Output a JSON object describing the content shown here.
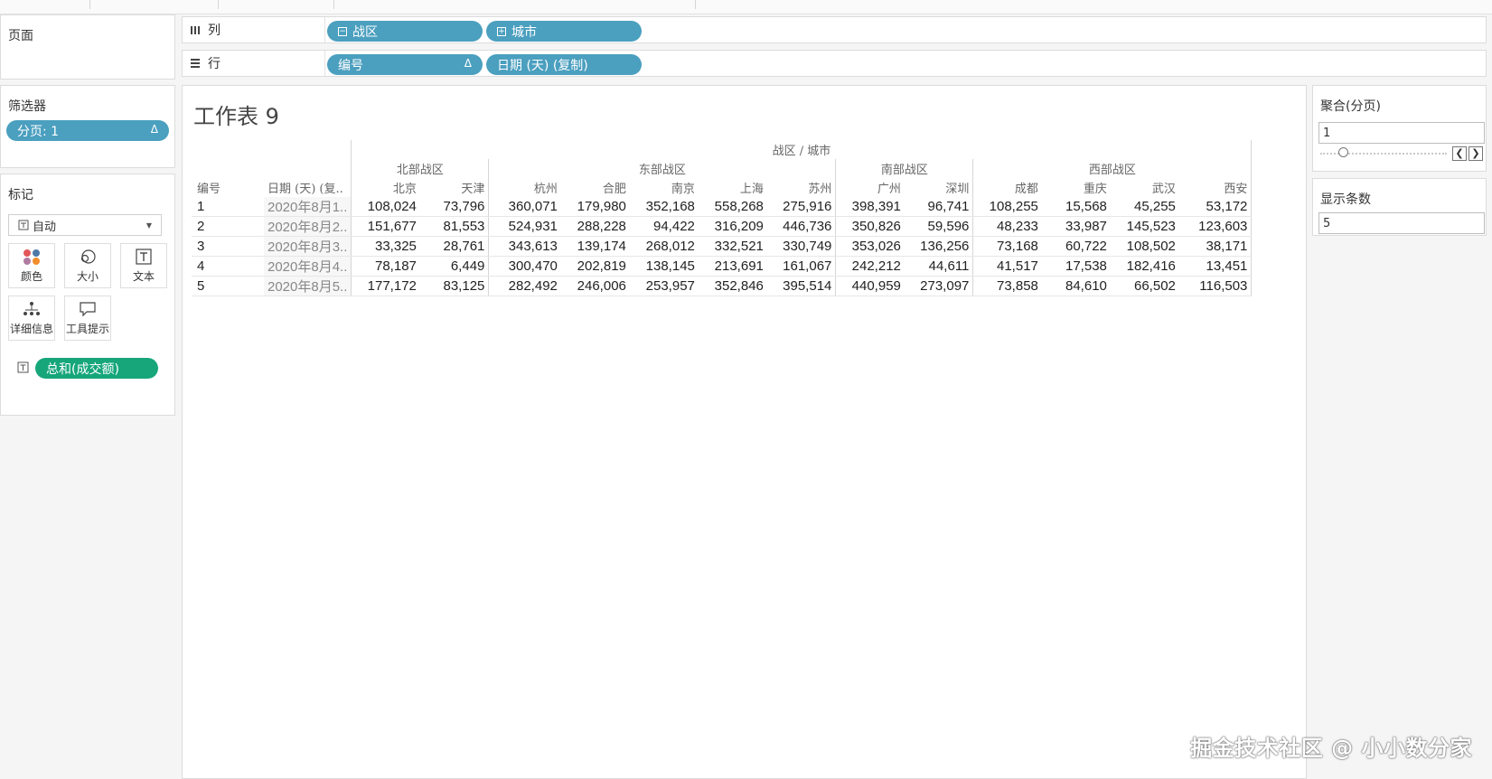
{
  "left": {
    "pages_title": "页面",
    "filters_title": "筛选器",
    "filter_pill": "分页: 1",
    "filter_pill_delta": "Δ",
    "marks_title": "标记",
    "mark_type": "自动",
    "mark_buttons": [
      {
        "label": "颜色",
        "icon": "color-dots-icon"
      },
      {
        "label": "大小",
        "icon": "size-circles-icon"
      },
      {
        "label": "文本",
        "icon": "text-icon"
      },
      {
        "label": "详细信息",
        "icon": "detail-icon"
      },
      {
        "label": "工具提示",
        "icon": "tooltip-icon"
      }
    ],
    "marks_field": "总和(成交额)"
  },
  "shelves": {
    "columns_label": "列",
    "rows_label": "行",
    "column_pills": [
      "战区",
      "城市"
    ],
    "row_pills": [
      "编号",
      "日期 (天) (复制)"
    ],
    "row_pill_delta": "Δ"
  },
  "sheet": {
    "title": "工作表 9",
    "header_top": "战区 / 城市",
    "row_headers": [
      "编号",
      "日期 (天) (复.."
    ],
    "regions": [
      {
        "name": "北部战区",
        "cities": [
          "北京",
          "天津"
        ]
      },
      {
        "name": "东部战区",
        "cities": [
          "杭州",
          "合肥",
          "南京",
          "上海",
          "苏州"
        ]
      },
      {
        "name": "南部战区",
        "cities": [
          "广州",
          "深圳"
        ]
      },
      {
        "name": "西部战区",
        "cities": [
          "成都",
          "重庆",
          "武汉",
          "西安"
        ]
      }
    ],
    "rows": [
      {
        "id": "1",
        "date": "2020年8月1..",
        "values": [
          "108,024",
          "73,796",
          "360,071",
          "179,980",
          "352,168",
          "558,268",
          "275,916",
          "398,391",
          "96,741",
          "108,255",
          "15,568",
          "45,255",
          "53,172"
        ]
      },
      {
        "id": "2",
        "date": "2020年8月2..",
        "values": [
          "151,677",
          "81,553",
          "524,931",
          "288,228",
          "94,422",
          "316,209",
          "446,736",
          "350,826",
          "59,596",
          "48,233",
          "33,987",
          "145,523",
          "123,603"
        ]
      },
      {
        "id": "3",
        "date": "2020年8月3..",
        "values": [
          "33,325",
          "28,761",
          "343,613",
          "139,174",
          "268,012",
          "332,521",
          "330,749",
          "353,026",
          "136,256",
          "73,168",
          "60,722",
          "108,502",
          "38,171"
        ]
      },
      {
        "id": "4",
        "date": "2020年8月4..",
        "values": [
          "78,187",
          "6,449",
          "300,470",
          "202,819",
          "138,145",
          "213,691",
          "161,067",
          "242,212",
          "44,611",
          "41,517",
          "17,538",
          "182,416",
          "13,451"
        ]
      },
      {
        "id": "5",
        "date": "2020年8月5..",
        "values": [
          "177,172",
          "83,125",
          "282,492",
          "246,006",
          "253,957",
          "352,846",
          "395,514",
          "440,959",
          "273,097",
          "73,858",
          "84,610",
          "66,502",
          "116,503"
        ]
      }
    ]
  },
  "right": {
    "agg_title": "聚合(分页)",
    "agg_value": "1",
    "count_title": "显示条数",
    "count_value": "5"
  },
  "watermark": "掘金技术社区 @ 小小数分家",
  "colors": {
    "blue_pill": "#4b9fbf",
    "green_pill": "#16a67a"
  }
}
